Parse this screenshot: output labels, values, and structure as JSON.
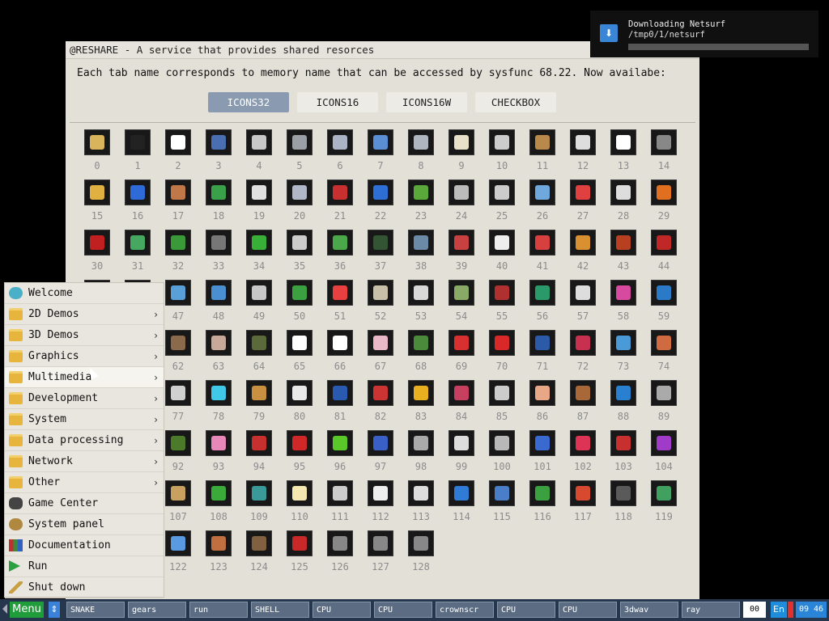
{
  "window": {
    "title": "@RESHARE - A service that provides shared resorces",
    "description": "Each tab name corresponds to memory name that can be accessed by sysfunc 68.22. Now availabe:",
    "tabs": [
      {
        "label": "ICONS32",
        "active": true
      },
      {
        "label": "ICONS16",
        "active": false
      },
      {
        "label": "ICONS16W",
        "active": false
      },
      {
        "label": "CHECKBOX",
        "active": false
      }
    ],
    "icon_count": 129,
    "icon_colors": [
      "#d9b45c",
      "#222222",
      "#ffffff",
      "#4a6fb0",
      "#c8c8c8",
      "#9aa0a6",
      "#aab4c4",
      "#5a8fd6",
      "#b0b6c0",
      "#e8e0c8",
      "#cccccc",
      "#b8894a",
      "#dddddd",
      "#ffffff",
      "#888888",
      "#e0b040",
      "#2f6bd8",
      "#c07848",
      "#3aa04a",
      "#e0e0e0",
      "#b0b8c8",
      "#c83030",
      "#2e6fd6",
      "#5aa83a",
      "#bbbbbb",
      "#cccccc",
      "#6fa8dc",
      "#e04040",
      "#dddddd",
      "#e07020",
      "#c02020",
      "#46a860",
      "#3a9a3a",
      "#777777",
      "#38b038",
      "#cccccc",
      "#4aa84a",
      "#335533",
      "#6a8aa8",
      "#c84040",
      "#eeeeee",
      "#d84040",
      "#d89030",
      "#b84020",
      "#c02828",
      "#4a7ed0",
      "#3a6ab0",
      "#5aa0d8",
      "#4a90d0",
      "#c8c8c8",
      "#3aa040",
      "#e84040",
      "#c8c0a8",
      "#d8d8d8",
      "#88aa66",
      "#b03030",
      "#2a9a6a",
      "#dddddd",
      "#d84aa0",
      "#2a7ac8",
      "#e8a020",
      "#a0a0a0",
      "#8a6a4a",
      "#c8a898",
      "#5a6a3a",
      "#ffffff",
      "#ffffff",
      "#e8b8c8",
      "#4a8a3a",
      "#d83030",
      "#d82828",
      "#2a5aa8",
      "#c83050",
      "#4a9ad8",
      "#d06a40",
      "#3a7a3a",
      "#3a7ad0",
      "#d0d0d0",
      "#40c8e8",
      "#c89040",
      "#e8e8e8",
      "#2a5ab0",
      "#cc3333",
      "#e8b020",
      "#c84060",
      "#cccccc",
      "#e8a888",
      "#a86838",
      "#2a80d0",
      "#aaaaaa",
      "#eeeeee",
      "#555555",
      "#4a7a2a",
      "#e888b8",
      "#c83030",
      "#d02828",
      "#5ac828",
      "#3a60c8",
      "#aaaaaa",
      "#dddddd",
      "#b8b8b8",
      "#3a6ad0",
      "#dd3355",
      "#c83030",
      "#a03ac8",
      "#6080d0",
      "#c0c0c0",
      "#c8a060",
      "#3aaa3a",
      "#3a9a9a",
      "#f4e8b0",
      "#cccccc",
      "#eeeeee",
      "#dddddd",
      "#2f7bd6",
      "#4a7ec8",
      "#3aa040",
      "#d84a30",
      "#5a5a5a",
      "#40a060",
      "#1a1a1a",
      "#e0d0c0",
      "#5a9ae0",
      "#c07040",
      "#806040",
      "#c82828"
    ]
  },
  "notification": {
    "title": "Downloading Netsurf",
    "path": "/tmp0/1/netsurf",
    "progress": 0.0,
    "icon": "download-arrow-icon"
  },
  "menu": {
    "items": [
      {
        "label": "Welcome",
        "icon": "wave-icon",
        "has_submenu": false
      },
      {
        "label": "2D Demos",
        "icon": "folder-icon",
        "has_submenu": true
      },
      {
        "label": "3D Demos",
        "icon": "folder-icon",
        "has_submenu": true
      },
      {
        "label": "Graphics",
        "icon": "folder-icon",
        "has_submenu": true
      },
      {
        "label": "Multimedia",
        "icon": "folder-icon",
        "has_submenu": true
      },
      {
        "label": "Development",
        "icon": "folder-icon",
        "has_submenu": true
      },
      {
        "label": "System",
        "icon": "folder-icon",
        "has_submenu": true
      },
      {
        "label": "Data processing",
        "icon": "folder-icon",
        "has_submenu": true
      },
      {
        "label": "Network",
        "icon": "folder-icon",
        "has_submenu": true
      },
      {
        "label": "Other",
        "icon": "folder-icon",
        "has_submenu": true
      },
      {
        "label": "Game Center",
        "icon": "gamepad-icon",
        "has_submenu": false
      },
      {
        "label": "System panel",
        "icon": "gears-icon",
        "has_submenu": false
      },
      {
        "label": "Documentation",
        "icon": "books-icon",
        "has_submenu": false
      },
      {
        "label": "Run",
        "icon": "play-icon",
        "has_submenu": false
      },
      {
        "label": "Shut down",
        "icon": "wand-icon",
        "has_submenu": false
      }
    ],
    "arrow": "›"
  },
  "taskbar": {
    "menu_label": "Menu",
    "sort_glyph": "⇕",
    "tasks": [
      "SNAKE",
      "gears",
      "run",
      "SHELL",
      "CPU",
      "CPU",
      "crownscr",
      "CPU",
      "CPU",
      "3dwav",
      "ray"
    ],
    "indicator": "00",
    "language": "En",
    "clock": "09 46"
  }
}
